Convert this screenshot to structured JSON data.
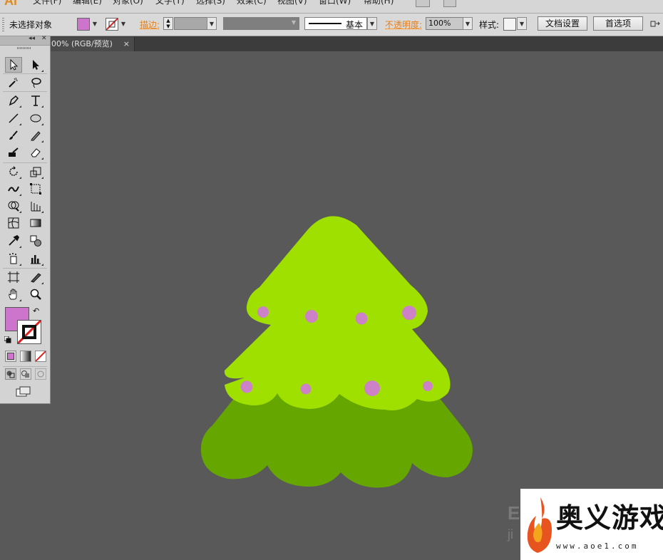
{
  "app": {
    "logo": "Ai"
  },
  "menus": [
    "文件(F)",
    "编辑(E)",
    "对象(O)",
    "文字(T)",
    "选择(S)",
    "效果(C)",
    "视图(V)",
    "窗口(W)",
    "帮助(H)"
  ],
  "control_bar": {
    "selection_status": "未选择对象",
    "stroke_label": "描边:",
    "brush_label": "基本",
    "opacity_label": "不透明度:",
    "opacity_value": "100%",
    "style_label": "样式:",
    "doc_setup_button": "文档设置",
    "preferences_button": "首选项"
  },
  "document_tab": {
    "title": "00% (RGB/预览)",
    "close": "×"
  },
  "colors": {
    "fill": "#cd74cd",
    "tree_top": "#a0e000",
    "tree_bottom": "#66a600",
    "ornament": "#cd82c8",
    "canvas": "#595959"
  },
  "watermark": {
    "name": "奥义游戏网",
    "url": "www.aoe1.com"
  }
}
